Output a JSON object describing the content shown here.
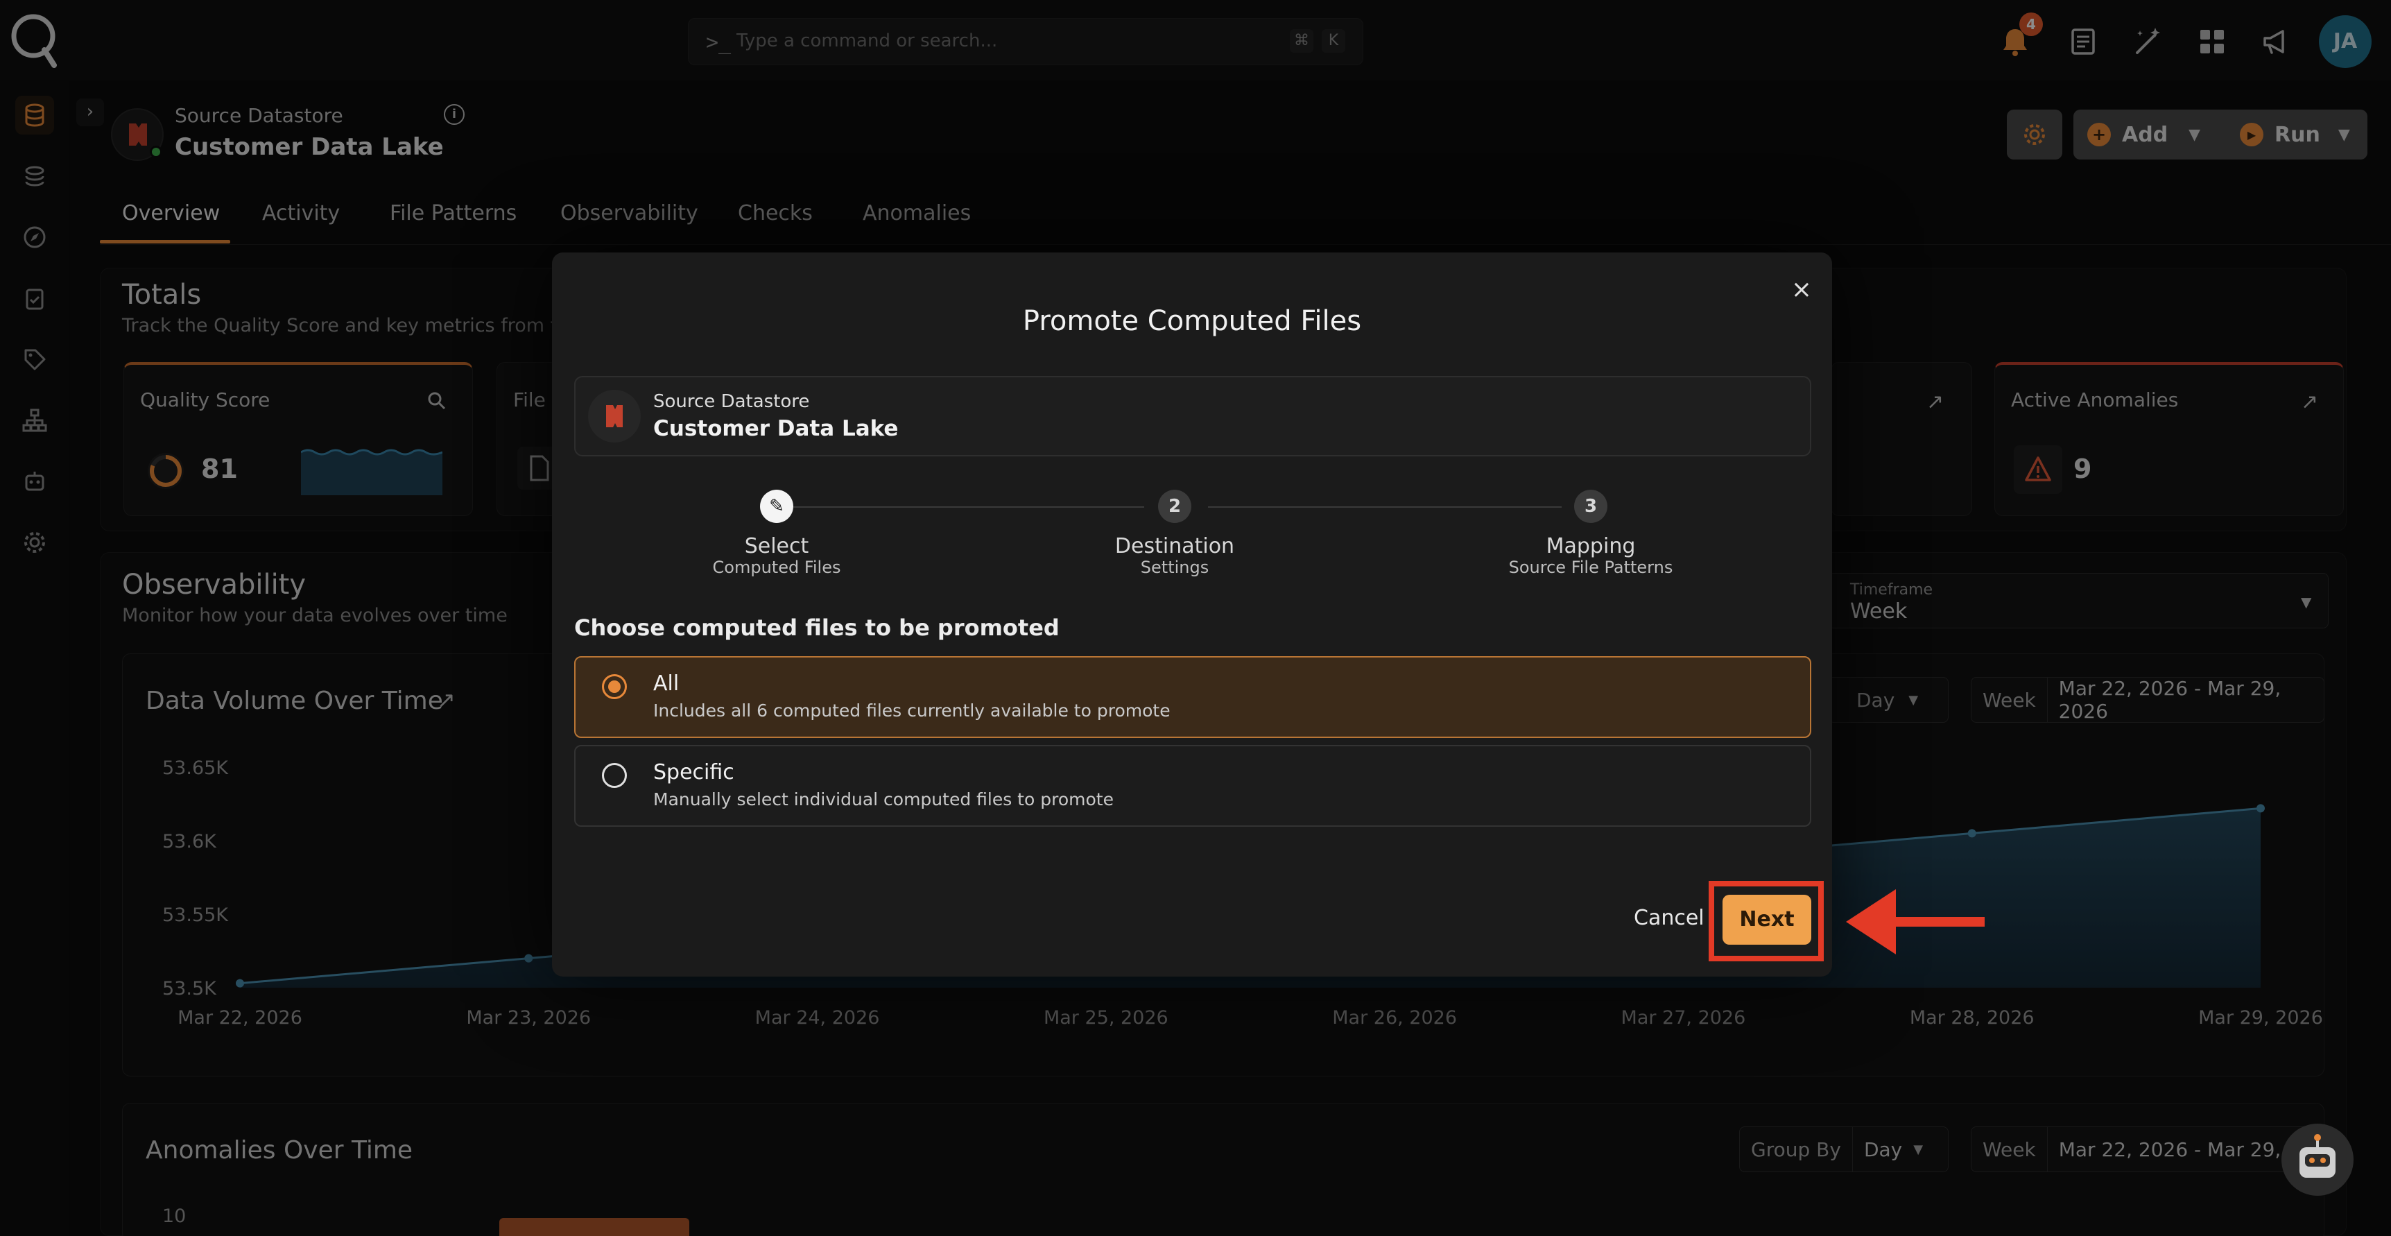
{
  "app": {
    "command_placeholder": "Type a command or search...",
    "command_prompt": ">_",
    "kbd_cmd": "⌘",
    "kbd_k": "K",
    "notifications_count": "4",
    "user_initials": "JA",
    "accent_color": "#e8893a"
  },
  "header": {
    "datastore_label": "Source Datastore",
    "datastore_name": "Customer Data Lake",
    "add_label": "Add",
    "run_label": "Run"
  },
  "tabs": [
    {
      "label": "Overview",
      "active": true
    },
    {
      "label": "Activity"
    },
    {
      "label": "File Patterns"
    },
    {
      "label": "Observability"
    },
    {
      "label": "Checks"
    },
    {
      "label": "Anomalies"
    }
  ],
  "totals": {
    "title": "Totals",
    "subtitle": "Track the Quality Score and key metrics from the",
    "quality_score_label": "Quality Score",
    "quality_score_value": "81",
    "file_label": "File I",
    "active_anomalies_label": "Active Anomalies",
    "active_anomalies_value": "9"
  },
  "observability": {
    "title": "Observability",
    "subtitle": "Monitor how your data evolves over time",
    "timeframe_label": "Timeframe",
    "timeframe_value": "Week"
  },
  "volume_chart": {
    "title": "Data Volume Over Time",
    "group_value": "Day",
    "range_label": "Week",
    "range_value": "Mar 22, 2026 - Mar 29, 2026"
  },
  "chart_data": {
    "type": "area",
    "title": "Data Volume Over Time",
    "x": [
      "Mar 22, 2026",
      "Mar 23, 2026",
      "Mar 24, 2026",
      "Mar 25, 2026",
      "Mar 26, 2026",
      "Mar 27, 2026",
      "Mar 28, 2026",
      "Mar 29, 2026"
    ],
    "y_ticks": [
      "53.65K",
      "53.6K",
      "53.55K",
      "53.5K"
    ],
    "ylim": [
      53500,
      53650
    ],
    "series": [
      {
        "values": [
          53503,
          53520,
          53537,
          53554,
          53571,
          53588,
          53605,
          53622
        ]
      }
    ],
    "visible_points": [
      0,
      1,
      6,
      7
    ],
    "color": "#4a8fb0"
  },
  "anomalies_chart": {
    "title": "Anomalies Over Time",
    "group_label": "Group By",
    "group_value": "Day",
    "range_label": "Week",
    "range_value": "Mar 22, 2026 - Mar 29, 2",
    "y_tick_top": "10"
  },
  "modal": {
    "title": "Promote Computed Files",
    "close_icon": "×",
    "datastore_label": "Source Datastore",
    "datastore_name": "Customer Data Lake",
    "steps": [
      {
        "number": "✎",
        "title": "Select",
        "subtitle": "Computed Files",
        "active": true
      },
      {
        "number": "2",
        "title": "Destination",
        "subtitle": "Settings"
      },
      {
        "number": "3",
        "title": "Mapping",
        "subtitle": "Source File Patterns"
      }
    ],
    "prompt": "Choose computed files to be promoted",
    "options": [
      {
        "title": "All",
        "description": "Includes all 6 computed files currently available to promote",
        "selected": true
      },
      {
        "title": "Specific",
        "description": "Manually select individual computed files to promote",
        "selected": false
      }
    ],
    "cancel_label": "Cancel",
    "next_label": "Next"
  }
}
